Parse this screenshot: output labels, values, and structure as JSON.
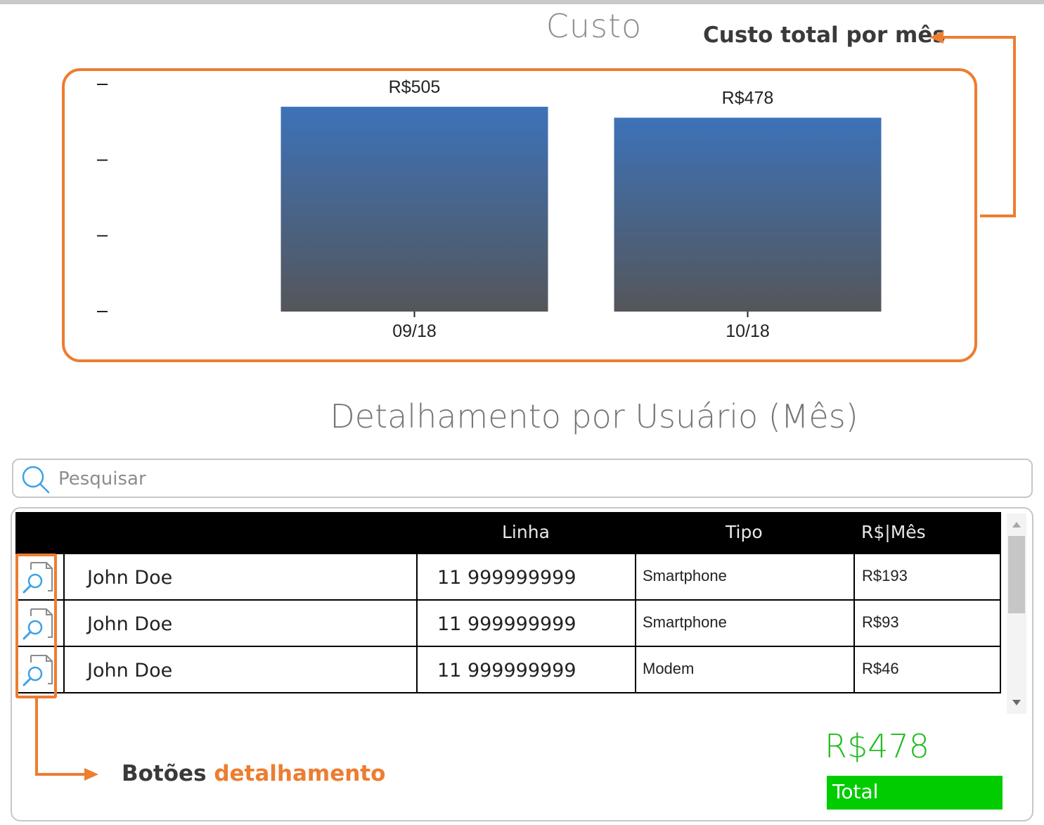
{
  "chart": {
    "title": "Custo",
    "annotation": "Custo total por mês"
  },
  "chart_data": {
    "type": "bar",
    "title": "Custo",
    "categories": [
      "09/18",
      "10/18"
    ],
    "values": [
      505,
      478
    ],
    "data_labels": [
      "R$505",
      "R$478"
    ],
    "xlabel": "",
    "ylabel": "",
    "ylim": [
      0,
      600
    ],
    "grid": false,
    "bar_gradient": [
      "#3d72b8",
      "#54565a"
    ]
  },
  "detail": {
    "title": "Detalhamento por Usuário (Mês)"
  },
  "search": {
    "placeholder": "Pesquisar",
    "value": ""
  },
  "table": {
    "headers": {
      "linha": "Linha",
      "tipo": "Tipo",
      "valor": "R$|Mês"
    },
    "rows": [
      {
        "name": "John Doe",
        "linha": "11 999999999",
        "tipo": "Smartphone",
        "valor": "R$193"
      },
      {
        "name": "John Doe",
        "linha": "11 999999999",
        "tipo": "Smartphone",
        "valor": "R$93"
      },
      {
        "name": "John Doe",
        "linha": "11 999999999",
        "tipo": "Modem",
        "valor": "R$46"
      }
    ]
  },
  "summary": {
    "total_value": "R$478",
    "total_label": "Total"
  },
  "annotation_bottom": {
    "prefix": "Botões",
    "accent": "detalhamento"
  },
  "colors": {
    "accent": "#ed7d31",
    "total_green": "#00cc00",
    "header_bg": "#000000"
  },
  "icons": {
    "search": "search-icon",
    "detail": "document-search-icon"
  }
}
